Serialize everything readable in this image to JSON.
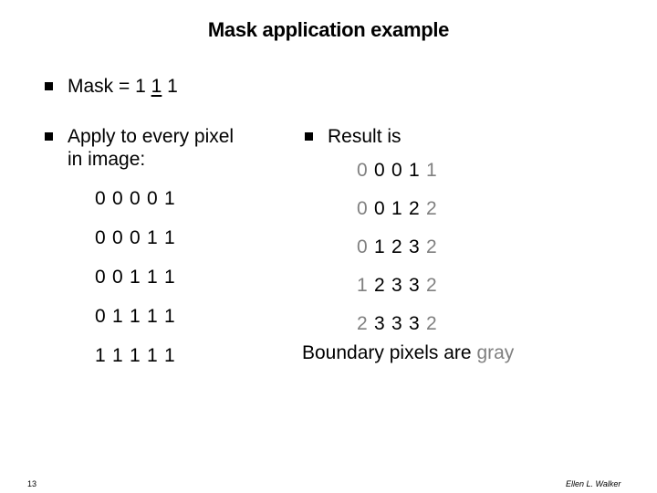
{
  "slide": {
    "title": "Mask application example",
    "colors": {
      "text": "#000000",
      "boundary": "#808080"
    },
    "bullets": [
      {
        "label": "Mask = ",
        "mask": [
          "1",
          "1",
          "1"
        ],
        "mask_center_index": 1
      },
      {
        "label_line1": "Apply to every pixel",
        "label_line2": "in image:"
      },
      {
        "label": "Result is"
      }
    ],
    "input_image": [
      [
        "0",
        "0",
        "0",
        "0",
        "1"
      ],
      [
        "0",
        "0",
        "0",
        "1",
        "1"
      ],
      [
        "0",
        "0",
        "1",
        "1",
        "1"
      ],
      [
        "0",
        "1",
        "1",
        "1",
        "1"
      ],
      [
        "1",
        "1",
        "1",
        "1",
        "1"
      ]
    ],
    "result_image": [
      [
        "0",
        "0",
        "0",
        "1",
        "1"
      ],
      [
        "0",
        "0",
        "1",
        "2",
        "2"
      ],
      [
        "0",
        "1",
        "2",
        "3",
        "2"
      ],
      [
        "1",
        "2",
        "3",
        "3",
        "2"
      ],
      [
        "2",
        "3",
        "3",
        "3",
        "2"
      ]
    ],
    "note_prefix": "Boundary pixels are ",
    "note_gray_word": "gray",
    "page_number": "13",
    "author": "Ellen L. Walker"
  }
}
